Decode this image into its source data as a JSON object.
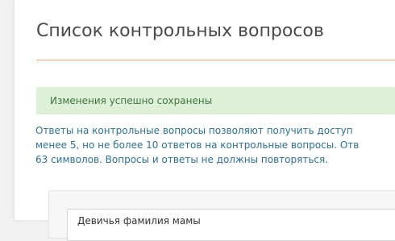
{
  "page": {
    "title": "Список контрольных вопросов"
  },
  "alert": {
    "success_text": "Изменения успешно сохранены"
  },
  "info": {
    "lines": [
      "Ответы на контрольные вопросы позволяют получить доступ",
      "менее 5, но не более 10 ответов на контрольные вопросы. Отв",
      "63 символов. Вопросы и ответы не должны повторяться."
    ]
  },
  "questions": [
    {
      "question": "Девичья фамилия мамы"
    }
  ],
  "colors": {
    "accent_rule": "#f2a37c",
    "success_bg": "#dff0d8",
    "success_text": "#3c763d",
    "info_text": "#31708f"
  }
}
